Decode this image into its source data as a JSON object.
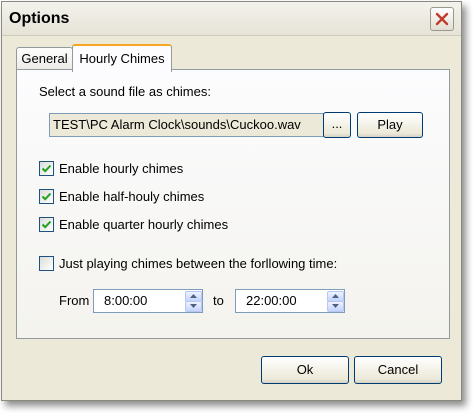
{
  "window": {
    "title": "Options"
  },
  "tabs": [
    {
      "label": "General",
      "active": false
    },
    {
      "label": "Hourly Chimes",
      "active": true
    }
  ],
  "chimes": {
    "sound_label": "Select a sound file as chimes:",
    "sound_path": "TEST\\PC Alarm Clock\\sounds\\Cuckoo.wav",
    "browse_label": "...",
    "play_label": "Play",
    "options": [
      {
        "label": "Enable hourly chimes",
        "checked": true
      },
      {
        "label": "Enable half-houly chimes",
        "checked": true
      },
      {
        "label": "Enable quarter hourly chimes",
        "checked": true
      }
    ],
    "range": {
      "label": "Just playing chimes between the forllowing time:",
      "checked": false,
      "from_label": "From",
      "from_value": "8:00:00",
      "to_label": "to",
      "to_value": "22:00:00"
    }
  },
  "footer": {
    "ok_label": "Ok",
    "cancel_label": "Cancel"
  },
  "colors": {
    "window_bg": "#ECE9D8",
    "checkmark": "#21a121",
    "tab_highlight": "#f5a623"
  }
}
